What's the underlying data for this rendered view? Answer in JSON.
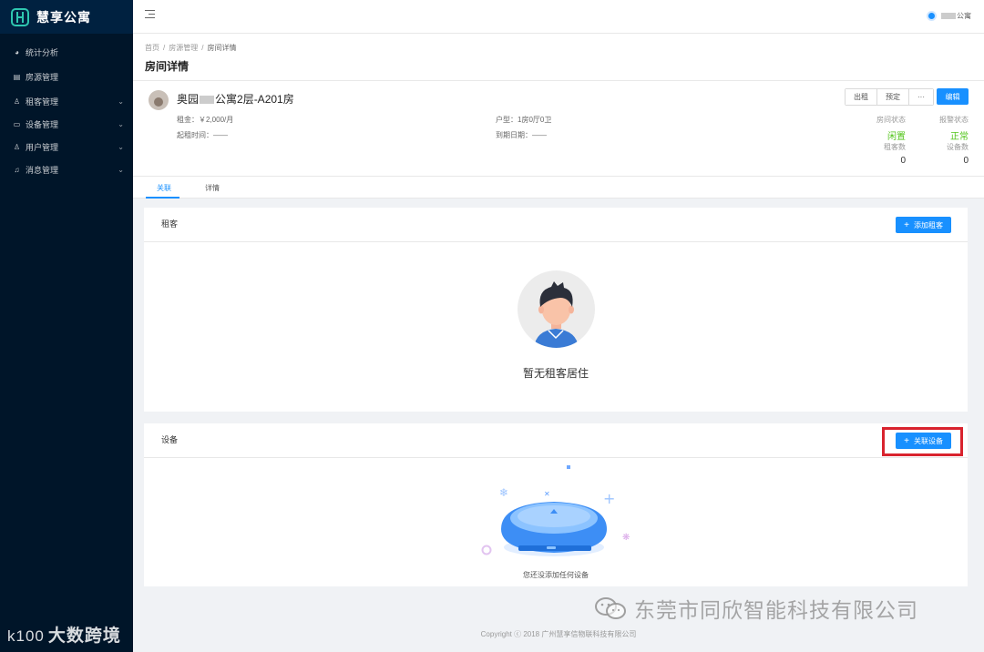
{
  "app": {
    "name": "慧享公寓"
  },
  "sidebar": {
    "items": [
      {
        "label": "统计分析",
        "icon": "pie-chart-icon",
        "expandable": false
      },
      {
        "label": "房源管理",
        "icon": "building-icon",
        "expandable": false
      },
      {
        "label": "租客管理",
        "icon": "user-icon",
        "expandable": true
      },
      {
        "label": "设备管理",
        "icon": "monitor-icon",
        "expandable": true
      },
      {
        "label": "用户管理",
        "icon": "user-icon",
        "expandable": true
      },
      {
        "label": "消息管理",
        "icon": "bell-icon",
        "expandable": true
      }
    ]
  },
  "header": {
    "user_name": "公寓"
  },
  "breadcrumb": [
    "首页",
    "房源管理",
    "房间详情"
  ],
  "page": {
    "title": "房间详情"
  },
  "room": {
    "name_prefix": "奥园",
    "name_suffix": "公寓2层-A201房",
    "rent_label": "租金：",
    "rent_value": "￥2,000/月",
    "layout_label": "户型：",
    "layout_value": "1房0厅0卫",
    "start_label": "起租时间：",
    "start_value": "——",
    "end_label": "到期日期：",
    "end_value": "——",
    "actions": [
      "出租",
      "预定",
      "···"
    ],
    "edit_label": "编辑",
    "stats": {
      "room_status_label": "房间状态",
      "room_status_value": "闲置",
      "alarm_status_label": "报警状态",
      "alarm_status_value": "正常",
      "tenant_count_label": "租客数",
      "tenant_count_value": "0",
      "device_count_label": "设备数",
      "device_count_value": "0"
    }
  },
  "tabs": [
    {
      "label": "关联",
      "active": true
    },
    {
      "label": "详情",
      "active": false
    }
  ],
  "tenant_card": {
    "title": "租客",
    "add_label": "添加租客",
    "empty_text": "暂无租客居住"
  },
  "device_card": {
    "title": "设备",
    "link_label": "关联设备",
    "empty_text": "您还没添加任何设备"
  },
  "footer": {
    "text": "Copyright ⓒ 2018 广州慧享信物联科技有限公司"
  },
  "watermarks": {
    "sidebar": "大数跨境",
    "sidebar_logo": "k100",
    "wechat": "东莞市同欣智能科技有限公司"
  },
  "colors": {
    "sidebar_bg": "#001529",
    "primary": "#1890ff",
    "success": "#52c41a",
    "highlight": "#d9232e"
  }
}
